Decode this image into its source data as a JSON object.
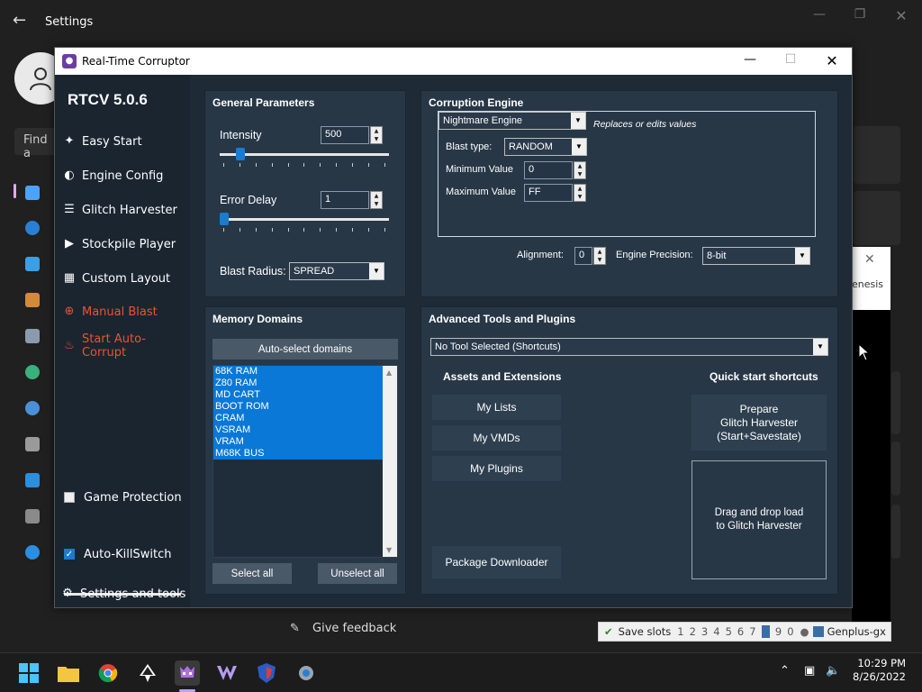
{
  "settings": {
    "title": "Settings",
    "back_icon": "arrow-left-icon",
    "find_placeholder": "Find a",
    "give_feedback": "Give feedback",
    "minimize_glyph": "—",
    "maximize_glyph": "❐",
    "close_glyph": "✕"
  },
  "emulator": {
    "fragment_text": "enesis",
    "close_glyph": "✕",
    "save_slots_label": "Save slots",
    "slots": [
      "1",
      "2",
      "3",
      "4",
      "5",
      "6",
      "7",
      "8",
      "9",
      "0"
    ],
    "active_slot": "8",
    "core_name": "Genplus-gx"
  },
  "rtc": {
    "window_title": "Real-Time Corruptor",
    "version": "RTCV 5.0.6",
    "sidebar": {
      "items": [
        {
          "label": "Easy Start",
          "icon": "magic-wand-icon"
        },
        {
          "label": "Engine Config",
          "icon": "gauge-icon"
        },
        {
          "label": "Glitch Harvester",
          "icon": "layers-icon"
        },
        {
          "label": "Stockpile Player",
          "icon": "play-icon"
        },
        {
          "label": "Custom Layout",
          "icon": "grid-icon"
        },
        {
          "label": "Manual Blast",
          "icon": "crosshair-icon"
        },
        {
          "label": "Start Auto-Corrupt",
          "icon": "fire-icon"
        }
      ],
      "game_protection": "Game Protection",
      "auto_killswitch": "Auto-KillSwitch",
      "settings_tools": "Settings and tools"
    },
    "general": {
      "title": "General Parameters",
      "intensity_label": "Intensity",
      "intensity_value": "500",
      "intensity_slider": 0.1,
      "error_delay_label": "Error Delay",
      "error_delay_value": "1",
      "error_delay_slider": 0.0,
      "blast_radius_label": "Blast Radius:",
      "blast_radius_value": "SPREAD"
    },
    "engine": {
      "title": "Corruption Engine",
      "engine_select": "Nightmare Engine",
      "engine_note": "Replaces or edits values",
      "blast_type_label": "Blast type:",
      "blast_type_value": "RANDOM",
      "min_label": "Minimum Value",
      "min_value": "0",
      "max_label": "Maximum Value",
      "max_value": "FF",
      "alignment_label": "Alignment:",
      "alignment_value": "0",
      "precision_label": "Engine Precision:",
      "precision_value": "8-bit"
    },
    "memory": {
      "title": "Memory Domains",
      "auto_select": "Auto-select domains",
      "domains": [
        "68K RAM",
        "Z80 RAM",
        "MD CART",
        "BOOT ROM",
        "CRAM",
        "VSRAM",
        "VRAM",
        "M68K BUS"
      ],
      "select_all": "Select all",
      "unselect_all": "Unselect all"
    },
    "advanced": {
      "title": "Advanced Tools and Plugins",
      "tool_select": "No Tool Selected (Shortcuts)",
      "assets_title": "Assets and Extensions",
      "my_lists": "My Lists",
      "my_vmds": "My VMDs",
      "my_plugins": "My Plugins",
      "package_downloader": "Package Downloader",
      "quick_title": "Quick start shortcuts",
      "prepare_line1": "Prepare",
      "prepare_line2": "Glitch Harvester",
      "prepare_line3": "(Start+Savestate)",
      "drop_line1": "Drag and drop load",
      "drop_line2": "to Glitch Harvester"
    }
  },
  "taskbar": {
    "icons": [
      "windows-start-icon",
      "file-explorer-icon",
      "chrome-icon",
      "inkscape-icon",
      "rtcv-icon",
      "vscodium-icon",
      "shield-app-icon",
      "settings-gear-icon"
    ],
    "time": "10:29 PM",
    "date": "8/26/2022"
  },
  "colors": {
    "accent_blue": "#0a78d7",
    "danger_orange": "#e8552f",
    "panel_bg": "#273746"
  }
}
